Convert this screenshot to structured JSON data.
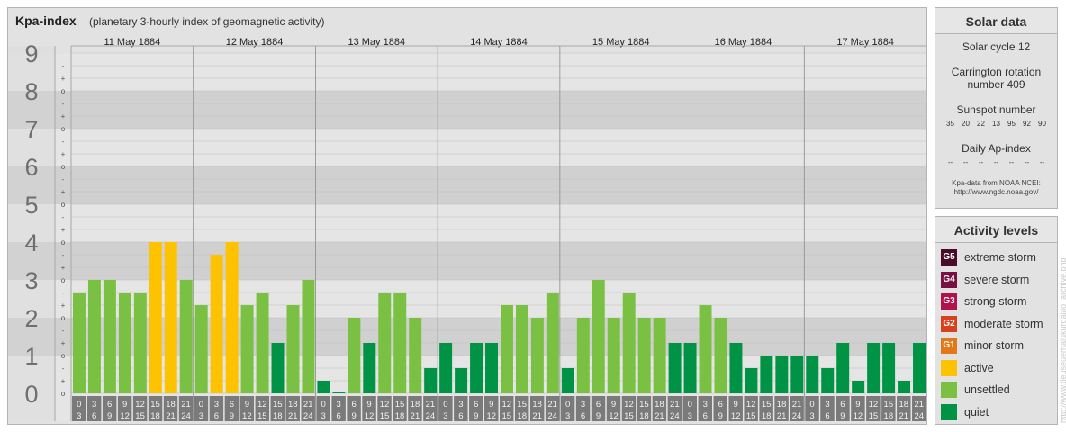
{
  "header": {
    "title": "Kpa-index",
    "subtitle": "(planetary 3-hourly index of geomagnetic activity)"
  },
  "chart_data": {
    "type": "bar",
    "y_axis": {
      "min": 0,
      "max": 9,
      "tick_labels": [
        "0",
        "1",
        "2",
        "3",
        "4",
        "5",
        "6",
        "7",
        "8",
        "9"
      ],
      "sub_labels": [
        "o",
        "+",
        "-"
      ]
    },
    "days": [
      "11 May 1884",
      "12 May 1884",
      "13 May 1884",
      "14 May 1884",
      "15 May 1884",
      "16 May 1884",
      "17 May 1884"
    ],
    "interval_labels": [
      {
        "start": "0",
        "end": "3"
      },
      {
        "start": "3",
        "end": "6"
      },
      {
        "start": "6",
        "end": "9"
      },
      {
        "start": "9",
        "end": "12"
      },
      {
        "start": "12",
        "end": "15"
      },
      {
        "start": "15",
        "end": "18"
      },
      {
        "start": "18",
        "end": "21"
      },
      {
        "start": "21",
        "end": "24"
      }
    ],
    "values": [
      2.667,
      3.0,
      3.0,
      2.667,
      2.667,
      4.0,
      4.0,
      3.0,
      2.333,
      3.667,
      4.0,
      2.333,
      2.667,
      1.333,
      2.333,
      3.0,
      0.333,
      0.0,
      2.0,
      1.333,
      2.667,
      2.667,
      2.0,
      0.667,
      1.333,
      0.667,
      1.333,
      1.333,
      2.333,
      2.333,
      2.0,
      2.667,
      0.667,
      2.0,
      3.0,
      2.0,
      2.667,
      2.0,
      2.0,
      1.333,
      1.333,
      2.333,
      2.0,
      1.333,
      0.667,
      1.0,
      1.0,
      1.0,
      1.0,
      0.667,
      1.333,
      0.333,
      1.333,
      1.333,
      0.333,
      1.333
    ],
    "colors": {
      "quiet": "#009245",
      "unsettled": "#7ac143",
      "active": "#fdc300",
      "bg_light": "#e5e5e5",
      "bg_dark": "#d0d0d0"
    }
  },
  "solar": {
    "title": "Solar data",
    "cycle": "Solar cycle 12",
    "carrington_line1": "Carrington rotation",
    "carrington_line2": "number 409",
    "sunspot_title": "Sunspot number",
    "sunspots": [
      "35",
      "20",
      "22",
      "13",
      "95",
      "92",
      "90"
    ],
    "ap_title": "Daily Ap-index",
    "ap_values": [
      "--",
      "--",
      "--",
      "--",
      "--",
      "--",
      "--"
    ],
    "source_line1": "Kpa-data from NOAA NCEI:",
    "source_line2": "http://www.ngdc.noaa.gov/"
  },
  "activity": {
    "title": "Activity levels",
    "items": [
      {
        "code": "G5",
        "label": "extreme storm",
        "color": "#4a0a2a"
      },
      {
        "code": "G4",
        "label": "severe storm",
        "color": "#7a1040"
      },
      {
        "code": "G3",
        "label": "strong storm",
        "color": "#b0124e"
      },
      {
        "code": "G2",
        "label": "moderate storm",
        "color": "#d9401e"
      },
      {
        "code": "G1",
        "label": "minor storm",
        "color": "#e2781a"
      },
      {
        "code": "",
        "label": "active",
        "color": "#fdc300"
      },
      {
        "code": "",
        "label": "unsettled",
        "color": "#7ac143"
      },
      {
        "code": "",
        "label": "quiet",
        "color": "#009245"
      }
    ]
  },
  "watermark": "http://www.tieuseuerhaiukurgal/jo_archive.php"
}
